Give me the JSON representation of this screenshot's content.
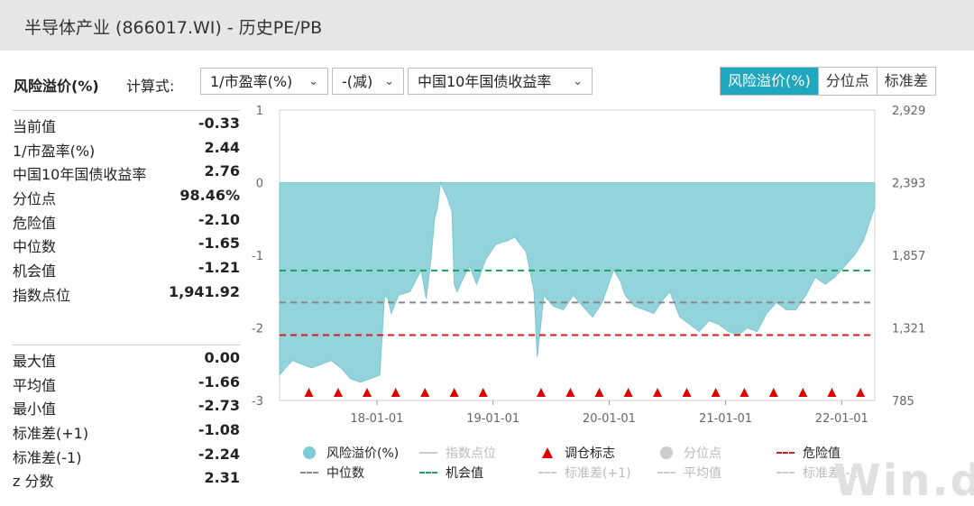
{
  "window": {
    "title": "半导体产业 (866017.WI) - 历史PE/PB"
  },
  "controls": {
    "section_label": "风险溢价(%)",
    "formula_label": "计算式:",
    "dropdowns": [
      "1/市盈率(%)",
      "-(减)",
      "中国10年国债收益率"
    ],
    "tabs": [
      {
        "label": "风险溢价(%)",
        "active": true
      },
      {
        "label": "分位点",
        "active": false
      },
      {
        "label": "标准差",
        "active": false
      }
    ]
  },
  "stats_top": [
    {
      "k": "当前值",
      "v": "-0.33"
    },
    {
      "k": "1/市盈率(%)",
      "v": "2.44"
    },
    {
      "k": "中国10年国债收益率",
      "v": "2.76"
    },
    {
      "k": "分位点",
      "v": "98.46%"
    },
    {
      "k": "危险值",
      "v": "-2.10"
    },
    {
      "k": "中位数",
      "v": "-1.65"
    },
    {
      "k": "机会值",
      "v": "-1.21"
    },
    {
      "k": "指数点位",
      "v": "1,941.92"
    }
  ],
  "stats_bottom": [
    {
      "k": "最大值",
      "v": "0.00"
    },
    {
      "k": "平均值",
      "v": "-1.66"
    },
    {
      "k": "最小值",
      "v": "-2.73"
    },
    {
      "k": "标准差(+1)",
      "v": "-1.08"
    },
    {
      "k": "标准差(-1)",
      "v": "-2.24"
    },
    {
      "k": "z 分数",
      "v": "2.31"
    }
  ],
  "chart_data": {
    "type": "area",
    "y_left": {
      "ticks": [
        "1",
        "0",
        "-1",
        "-2",
        "-3"
      ],
      "range": [
        -3,
        1
      ]
    },
    "y_right": {
      "ticks": [
        "2,929",
        "2,393",
        "1,857",
        "1,321",
        "785"
      ]
    },
    "x_tick_labels": [
      "18-01-01",
      "19-01-01",
      "20-01-01",
      "21-01-01",
      "22-01-01"
    ],
    "x_range": [
      "2017-03-01",
      "2022-04-15"
    ],
    "x_ticks": [
      "2018-01-01",
      "2019-01-01",
      "2020-01-01",
      "2021-01-01",
      "2022-01-01"
    ],
    "series": [
      {
        "name": "风险溢价(%)",
        "x": [
          "2017-03-01",
          "2017-03-20",
          "2017-04-10",
          "2017-05-10",
          "2017-06-10",
          "2017-07-10",
          "2017-08-10",
          "2017-09-10",
          "2017-10-10",
          "2017-11-10",
          "2017-12-10",
          "2018-01-10",
          "2018-01-25",
          "2018-02-05",
          "2018-02-15",
          "2018-03-10",
          "2018-04-15",
          "2018-05-20",
          "2018-06-05",
          "2018-06-20",
          "2018-07-01",
          "2018-07-10",
          "2018-07-20",
          "2018-08-10",
          "2018-08-25",
          "2018-09-01",
          "2018-09-10",
          "2018-10-01",
          "2018-10-20",
          "2018-11-10",
          "2018-12-10",
          "2019-01-10",
          "2019-02-15",
          "2019-03-10",
          "2019-04-15",
          "2019-05-10",
          "2019-05-20",
          "2019-06-10",
          "2019-07-10",
          "2019-08-10",
          "2019-09-10",
          "2019-10-10",
          "2019-11-10",
          "2019-12-10",
          "2020-01-15",
          "2020-02-05",
          "2020-02-20",
          "2020-03-20",
          "2020-04-20",
          "2020-05-20",
          "2020-06-20",
          "2020-07-10",
          "2020-08-10",
          "2020-09-10",
          "2020-10-10",
          "2020-11-10",
          "2020-12-10",
          "2021-01-10",
          "2021-02-10",
          "2021-03-10",
          "2021-04-10",
          "2021-05-10",
          "2021-06-10",
          "2021-07-10",
          "2021-08-10",
          "2021-09-10",
          "2021-10-10",
          "2021-11-10",
          "2021-12-10",
          "2022-01-10",
          "2022-02-10",
          "2022-03-10",
          "2022-04-15"
        ],
        "values": [
          -2.65,
          -2.55,
          -2.45,
          -2.5,
          -2.55,
          -2.5,
          -2.45,
          -2.55,
          -2.7,
          -2.75,
          -2.7,
          -2.65,
          -1.55,
          -1.6,
          -1.8,
          -1.55,
          -1.5,
          -1.2,
          -1.6,
          -1.05,
          -0.5,
          -0.35,
          0.0,
          -0.2,
          -0.4,
          -1.4,
          -1.5,
          -1.3,
          -1.15,
          -1.4,
          -1.05,
          -0.85,
          -0.8,
          -0.75,
          -0.95,
          -1.5,
          -2.4,
          -1.55,
          -1.7,
          -1.75,
          -1.55,
          -1.7,
          -1.85,
          -1.65,
          -1.2,
          -1.35,
          -1.55,
          -1.7,
          -1.75,
          -1.8,
          -1.6,
          -1.5,
          -1.85,
          -1.95,
          -2.05,
          -1.9,
          -1.95,
          -2.05,
          -2.1,
          -2.0,
          -2.05,
          -1.8,
          -1.65,
          -1.75,
          -1.75,
          -1.55,
          -1.3,
          -1.4,
          -1.3,
          -1.15,
          -1.0,
          -0.8,
          -0.33
        ]
      }
    ],
    "ref_lines": [
      {
        "name": "机会值",
        "value": -1.21,
        "color": "#1e9e5a"
      },
      {
        "name": "中位数",
        "value": -1.65,
        "color": "#888888"
      },
      {
        "name": "危险值",
        "value": -2.1,
        "color": "#cc1f1f"
      }
    ],
    "rebalance_markers": [
      "2017-06-01",
      "2017-09-01",
      "2017-12-01",
      "2018-03-01",
      "2018-06-01",
      "2018-09-01",
      "2018-12-01",
      "2019-06-01",
      "2019-09-01",
      "2019-12-01",
      "2020-03-01",
      "2020-06-01",
      "2020-09-01",
      "2020-12-01",
      "2021-03-01",
      "2021-06-01",
      "2021-09-01",
      "2021-12-01",
      "2022-03-01"
    ],
    "legend": [
      {
        "label": "风险溢价(%)",
        "sym": "dot",
        "color": "#7ccbd6",
        "muted": false
      },
      {
        "label": "指数点位",
        "sym": "line",
        "color": "#cccccc",
        "muted": true
      },
      {
        "label": "调仓标志",
        "sym": "tri",
        "color": "#e00000",
        "muted": false
      },
      {
        "label": "分位点",
        "sym": "dot",
        "color": "#cccccc",
        "muted": true
      },
      {
        "label": "危险值",
        "sym": "dash",
        "color": "#cc1f1f",
        "muted": false
      },
      {
        "label": "中位数",
        "sym": "dash",
        "color": "#888888",
        "muted": false
      },
      {
        "label": "机会值",
        "sym": "dashdot",
        "color": "#1e9e5a",
        "muted": false
      },
      {
        "label": "标准差(+1)",
        "sym": "dash",
        "color": "#cccccc",
        "muted": true
      },
      {
        "label": "平均值",
        "sym": "dash",
        "color": "#cccccc",
        "muted": true
      },
      {
        "label": "标准差(-1)",
        "sym": "dash",
        "color": "#cccccc",
        "muted": true
      }
    ]
  },
  "watermark": "Win.d"
}
